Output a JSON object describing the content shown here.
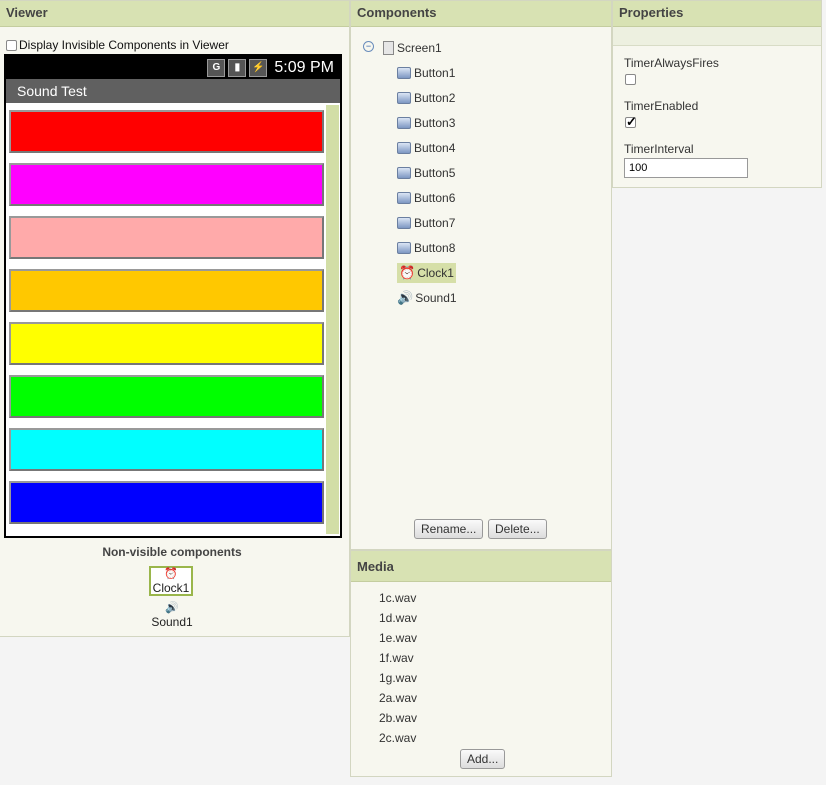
{
  "viewer": {
    "header": "Viewer",
    "display_invisible_label": "Display Invisible Components in Viewer",
    "phone": {
      "time": "5:09 PM",
      "status_icons": [
        "G"
      ],
      "app_title": "Sound Test"
    },
    "color_buttons": [
      {
        "name": "Button1",
        "color": "#ff0000"
      },
      {
        "name": "Button2",
        "color": "#ff00ff"
      },
      {
        "name": "Button3",
        "color": "#ffaaaa"
      },
      {
        "name": "Button4",
        "color": "#ffc800"
      },
      {
        "name": "Button5",
        "color": "#ffff00"
      },
      {
        "name": "Button6",
        "color": "#00ff00"
      },
      {
        "name": "Button7",
        "color": "#00ffff"
      },
      {
        "name": "Button8",
        "color": "#0000ff"
      }
    ],
    "nonvisible_title": "Non-visible components",
    "nonvisible": [
      "Clock1",
      "Sound1"
    ]
  },
  "components": {
    "header": "Components",
    "root": "Screen1",
    "items": [
      "Button1",
      "Button2",
      "Button3",
      "Button4",
      "Button5",
      "Button6",
      "Button7",
      "Button8",
      "Clock1",
      "Sound1"
    ],
    "selected": "Clock1",
    "rename_label": "Rename...",
    "delete_label": "Delete..."
  },
  "media": {
    "header": "Media",
    "files": [
      "1c.wav",
      "1d.wav",
      "1e.wav",
      "1f.wav",
      "1g.wav",
      "2a.wav",
      "2b.wav",
      "2c.wav"
    ],
    "add_label": "Add..."
  },
  "properties": {
    "header": "Properties",
    "timer_always_fires_label": "TimerAlwaysFires",
    "timer_always_fires": false,
    "timer_enabled_label": "TimerEnabled",
    "timer_enabled": true,
    "timer_interval_label": "TimerInterval",
    "timer_interval": "100"
  },
  "colors": {
    "header_bg": "#d8e2b3",
    "panel_bg": "#f7f7ef",
    "selection": "#d6dfa8"
  }
}
